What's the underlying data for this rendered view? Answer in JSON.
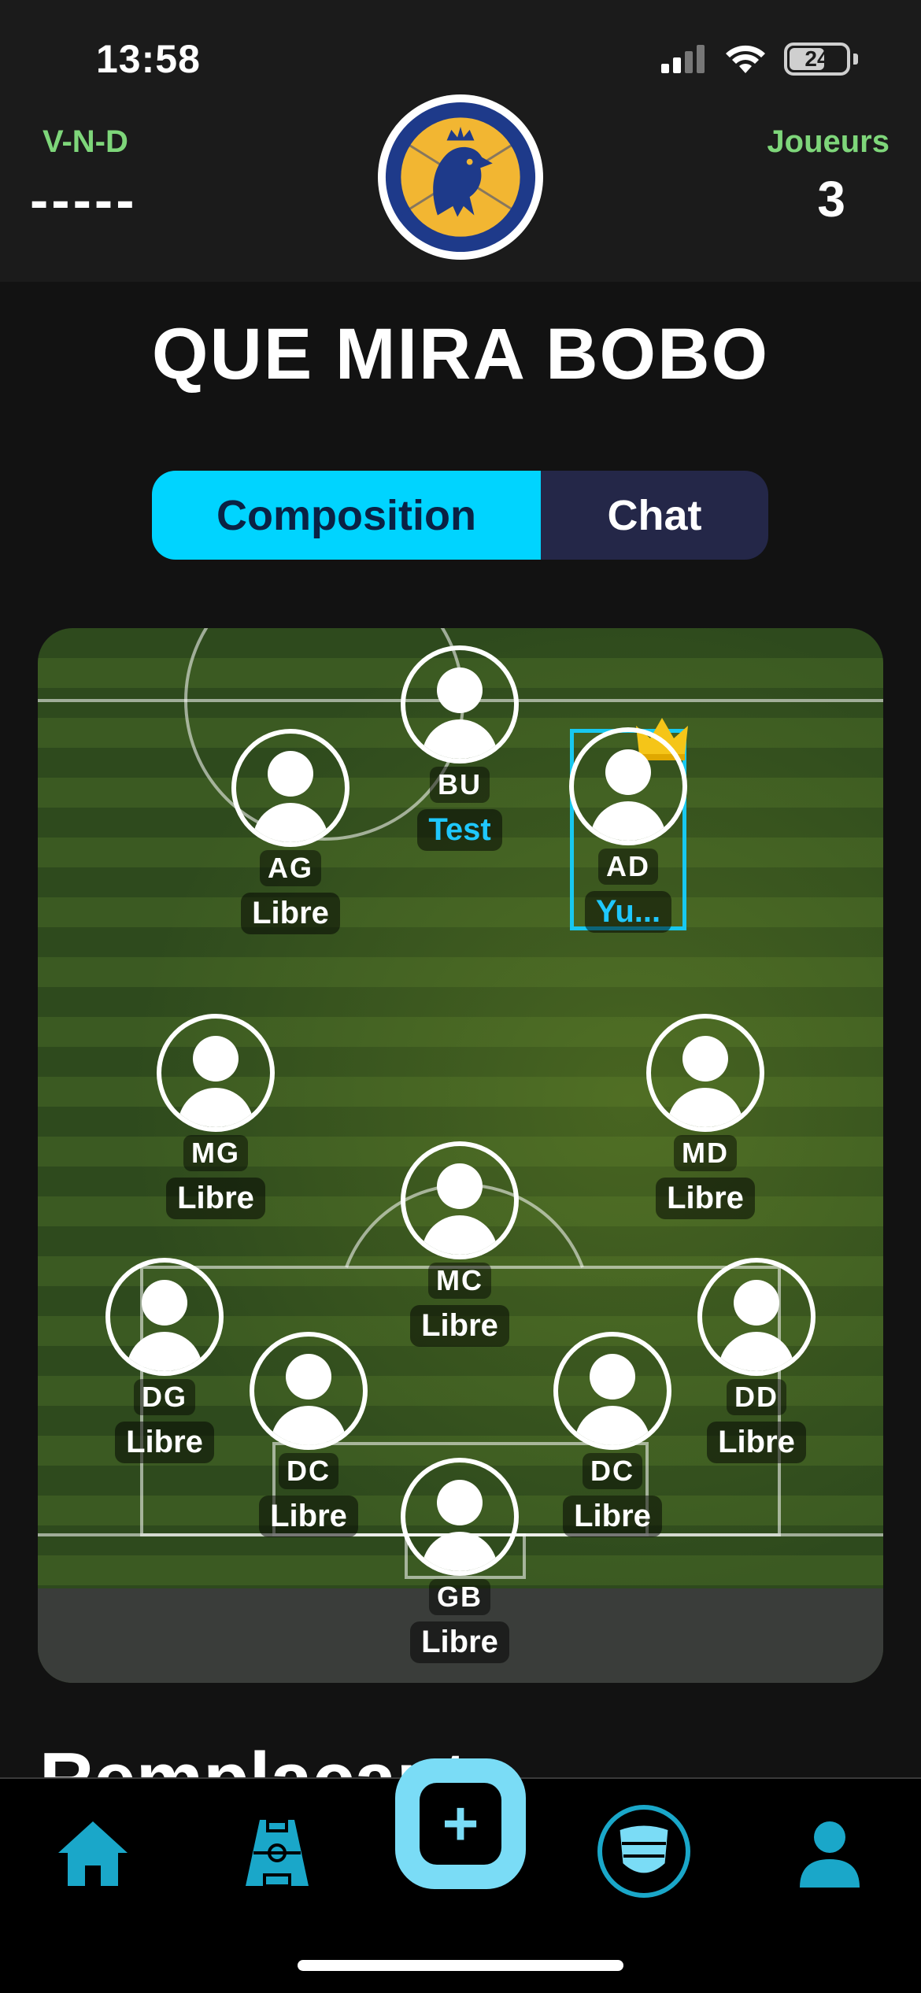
{
  "status_bar": {
    "time": "13:58",
    "battery": "24"
  },
  "header": {
    "record_label": "V-N-D",
    "record_value": "-----",
    "players_label": "Joueurs",
    "players_value": "3"
  },
  "team": {
    "name": "QUE MIRA BOBO"
  },
  "tabs": [
    {
      "label": "Composition",
      "active": true
    },
    {
      "label": "Chat",
      "active": false
    }
  ],
  "lineup": {
    "BU": {
      "position": "BU",
      "player": "Test"
    },
    "AG": {
      "position": "AG",
      "player": "Libre"
    },
    "AD": {
      "position": "AD",
      "player": "Yu..."
    },
    "MG": {
      "position": "MG",
      "player": "Libre"
    },
    "MD": {
      "position": "MD",
      "player": "Libre"
    },
    "MC": {
      "position": "MC",
      "player": "Libre"
    },
    "DG": {
      "position": "DG",
      "player": "Libre"
    },
    "DD": {
      "position": "DD",
      "player": "Libre"
    },
    "DC1": {
      "position": "DC",
      "player": "Libre"
    },
    "DC2": {
      "position": "DC",
      "player": "Libre"
    },
    "GB": {
      "position": "GB",
      "player": "Libre"
    }
  },
  "substitutes": {
    "title": "Remplaçants"
  },
  "nav": {
    "items": [
      "home-icon",
      "pitch-icon",
      "add-icon",
      "team-badge-icon",
      "profile-icon"
    ],
    "add_symbol": "+"
  },
  "colors": {
    "accent": "#00d4ff",
    "nav_accent": "#1aa7c9",
    "record_green": "#7ed67a",
    "tab_inactive": "#242748",
    "logo_blue": "#1e3a8a",
    "logo_gold": "#f2b632"
  }
}
